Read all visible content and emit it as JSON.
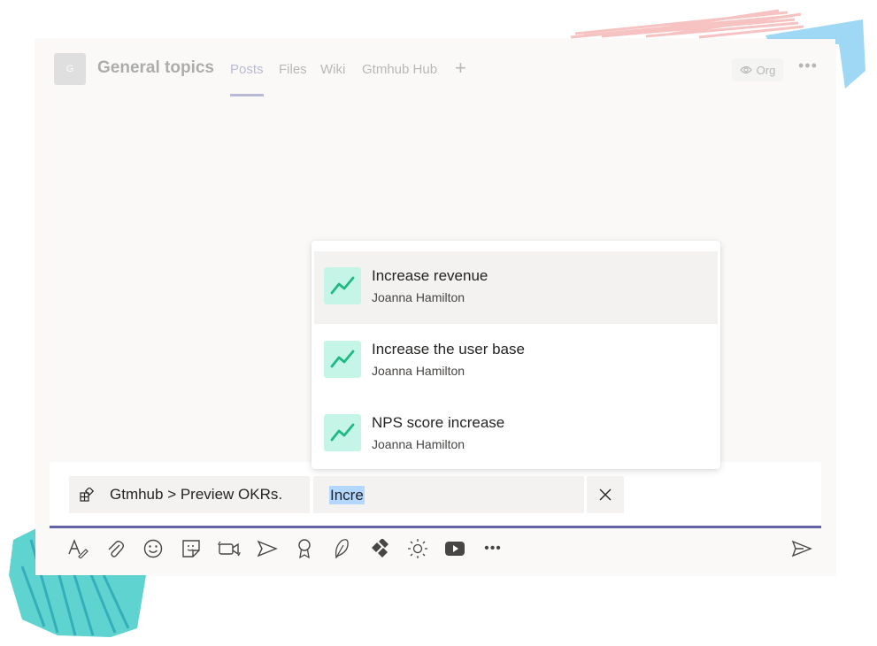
{
  "header": {
    "avatar_letter": "G",
    "channel_name": "General topics",
    "tabs": [
      {
        "label": "Posts"
      },
      {
        "label": "Files"
      },
      {
        "label": "Wiki"
      },
      {
        "label": "Gtmhub Hub"
      }
    ],
    "add_tab_label": "+",
    "org_label": "Org",
    "more_label": "•••"
  },
  "dropdown": {
    "items": [
      {
        "title": "Increase revenue",
        "owner": "Joanna Hamilton",
        "selected": true
      },
      {
        "title": "Increase the user base",
        "owner": "Joanna Hamilton",
        "selected": false
      },
      {
        "title": "NPS score increase",
        "owner": "Joanna Hamilton",
        "selected": false
      }
    ]
  },
  "compose": {
    "extension_label": "Gtmhub > Preview OKRs.",
    "search_value": "Incre"
  },
  "toolbar": {
    "tools": [
      "format-icon",
      "attach-icon",
      "emoji-icon",
      "sticker-icon",
      "meet-icon",
      "stream-icon",
      "praise-icon",
      "feather-icon",
      "jira-icon",
      "weather-icon",
      "youtube-icon",
      "more-icon"
    ],
    "more_label": "•••"
  },
  "colors": {
    "accent": "#6264a7",
    "okr_icon_bg": "#c5f5e6",
    "okr_icon_line": "#1fba84",
    "selected_row": "#f3f2f1"
  }
}
